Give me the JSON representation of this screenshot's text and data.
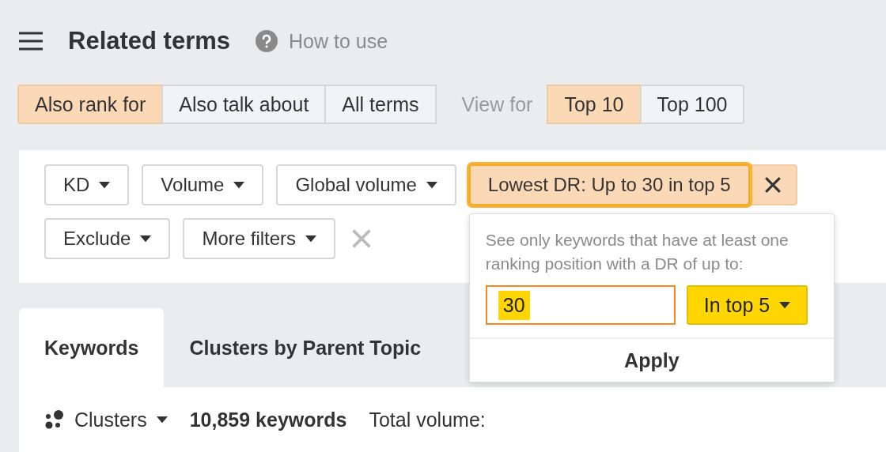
{
  "header": {
    "title": "Related terms",
    "help_link": "How to use"
  },
  "term_tabs": [
    {
      "label": "Also rank for",
      "selected": true
    },
    {
      "label": "Also talk about",
      "selected": false
    },
    {
      "label": "All terms",
      "selected": false
    }
  ],
  "view_for": {
    "label": "View for",
    "options": [
      {
        "label": "Top 10",
        "selected": true
      },
      {
        "label": "Top 100",
        "selected": false
      }
    ]
  },
  "filter_rows": [
    [
      {
        "label": "KD",
        "active": false
      },
      {
        "label": "Volume",
        "active": false
      },
      {
        "label": "Global volume",
        "active": false
      },
      {
        "label": "Lowest DR: Up to 30 in top 5",
        "active": true
      }
    ],
    [
      {
        "label": "Exclude",
        "active": false
      },
      {
        "label": "More filters",
        "active": false
      }
    ]
  ],
  "popup": {
    "description": "See only keywords that have at least one ranking position with a DR of up to:",
    "value": "30",
    "position": "In top 5",
    "apply": "Apply"
  },
  "result_tabs": [
    {
      "label": "Keywords",
      "selected": true
    },
    {
      "label": "Clusters by Parent Topic",
      "selected": false
    }
  ],
  "stats": {
    "view": "Clusters",
    "count": "10,859 keywords",
    "total": "Total volume:"
  }
}
